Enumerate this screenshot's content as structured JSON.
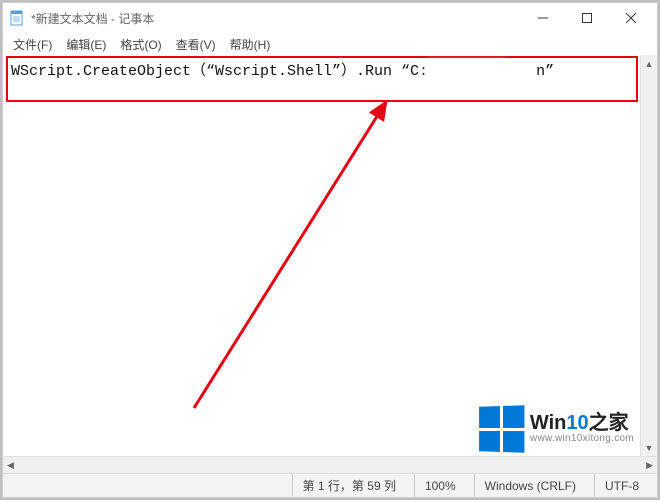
{
  "window": {
    "title": "*新建文本文档 - 记事本"
  },
  "menubar": {
    "file": "文件(F)",
    "edit": "编辑(E)",
    "format": "格式(O)",
    "view": "查看(V)",
    "help": "帮助(H)"
  },
  "editor": {
    "content": "WScript.CreateObject（“Wscript.Shell”）.Run “C:\\d          n”"
  },
  "statusbar": {
    "position": "第 1 行，第 59 列",
    "zoom": "100%",
    "line_ending": "Windows (CRLF)",
    "encoding": "UTF-8"
  },
  "watermark": {
    "brand_prefix": "Win",
    "brand_accent": "10",
    "brand_suffix": "之家",
    "url": "www.win10xitong.com"
  },
  "icons": {
    "notepad": "notepad-icon",
    "minimize": "minimize-icon",
    "maximize": "maximize-icon",
    "close": "close-icon"
  },
  "colors": {
    "highlight": "#e30613",
    "accent": "#0078d7"
  }
}
